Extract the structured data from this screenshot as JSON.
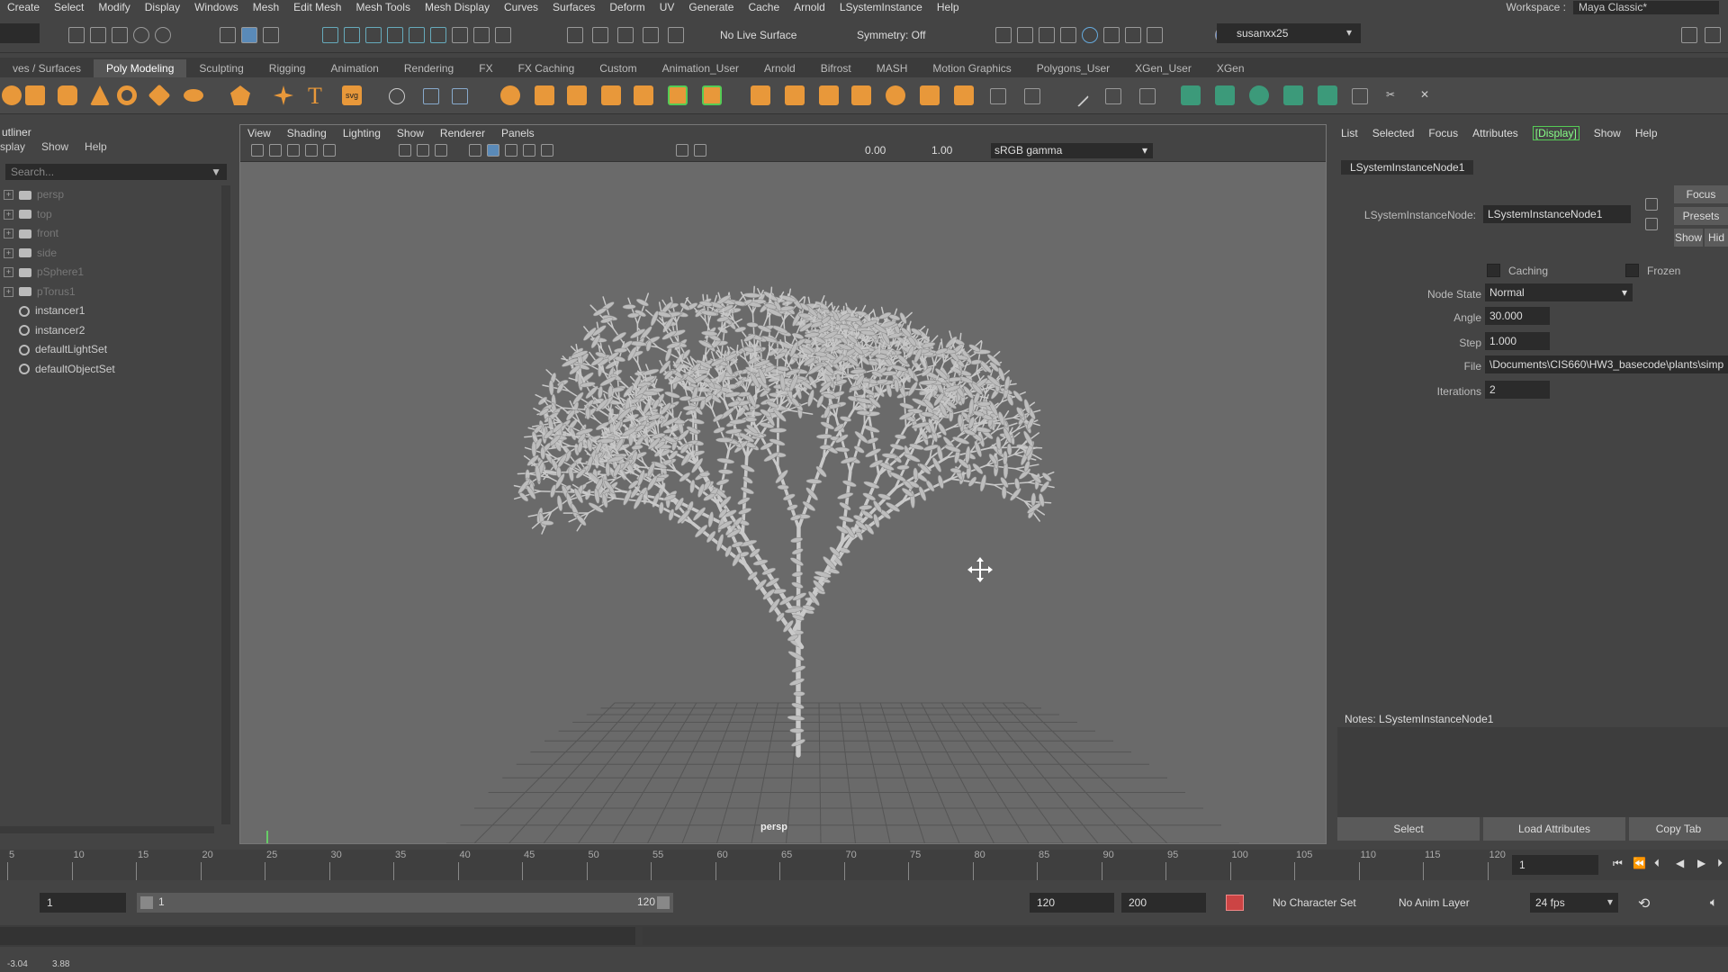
{
  "menubar": {
    "items": [
      "Create",
      "Select",
      "Modify",
      "Display",
      "Windows",
      "Mesh",
      "Edit Mesh",
      "Mesh Tools",
      "Mesh Display",
      "Curves",
      "Surfaces",
      "Deform",
      "UV",
      "Generate",
      "Cache",
      "Arnold",
      "LSystemInstance",
      "Help"
    ],
    "workspace_label": "Workspace :",
    "workspace_value": "Maya Classic*"
  },
  "statusline": {
    "live_surface": "No Live Surface",
    "symmetry": "Symmetry: Off",
    "user": "susanxx25"
  },
  "shelf": {
    "tabs": [
      "ves / Surfaces",
      "Poly Modeling",
      "Sculpting",
      "Rigging",
      "Animation",
      "Rendering",
      "FX",
      "FX Caching",
      "Custom",
      "Animation_User",
      "Arnold",
      "Bifrost",
      "MASH",
      "Motion Graphics",
      "Polygons_User",
      "XGen_User",
      "XGen"
    ],
    "active_tab": "Poly Modeling",
    "icon_names": [
      "sphere-icon",
      "cube-icon",
      "cylinder-icon",
      "cone-icon",
      "torus-icon",
      "plane-icon",
      "disc-icon",
      "platonic-icon",
      "star-icon",
      "text-icon",
      "svg-icon"
    ]
  },
  "outliner": {
    "title": "utliner",
    "menu": [
      "splay",
      "Show",
      "Help"
    ],
    "search_placeholder": "Search...",
    "items": [
      {
        "label": "persp",
        "expandable": true,
        "dim": true
      },
      {
        "label": "top",
        "expandable": true,
        "dim": true
      },
      {
        "label": "front",
        "expandable": true,
        "dim": true
      },
      {
        "label": "side",
        "expandable": true,
        "dim": true
      },
      {
        "label": "pSphere1",
        "expandable": true,
        "dim": true
      },
      {
        "label": "pTorus1",
        "expandable": true,
        "dim": true
      },
      {
        "label": "instancer1",
        "expandable": false,
        "dim": false
      },
      {
        "label": "instancer2",
        "expandable": false,
        "dim": false
      },
      {
        "label": "defaultLightSet",
        "expandable": false,
        "dim": false
      },
      {
        "label": "defaultObjectSet",
        "expandable": false,
        "dim": false
      }
    ]
  },
  "viewport": {
    "menu": [
      "View",
      "Shading",
      "Lighting",
      "Show",
      "Renderer",
      "Panels"
    ],
    "exposure": "0.00",
    "gamma_value": "1.00",
    "color_space": "sRGB gamma",
    "camera_label": "persp"
  },
  "attribute_editor": {
    "menu": [
      "List",
      "Selected",
      "Focus",
      "Attributes",
      "[Display]",
      "Show",
      "Help"
    ],
    "node_tab": "LSystemInstanceNode1",
    "node_label": "LSystemInstanceNode:",
    "node_value": "LSystemInstanceNode1",
    "side_buttons": [
      "Focus",
      "Presets",
      "Show",
      "Hid"
    ],
    "caching_label": "Caching",
    "frozen_label": "Frozen",
    "node_state_label": "Node State",
    "node_state_value": "Normal",
    "angle_label": "Angle",
    "angle_value": "30.000",
    "step_label": "Step",
    "step_value": "1.000",
    "file_label": "File",
    "file_value": "\\Documents\\CIS660\\HW3_basecode\\plants\\simp",
    "iterations_label": "Iterations",
    "iterations_value": "2",
    "notes_label": "Notes:  LSystemInstanceNode1",
    "buttons": [
      "Select",
      "Load Attributes",
      "Copy Tab"
    ]
  },
  "timeline": {
    "ticks": [
      "5",
      "10",
      "15",
      "20",
      "25",
      "30",
      "35",
      "40",
      "45",
      "50",
      "55",
      "60",
      "65",
      "70",
      "75",
      "80",
      "85",
      "90",
      "95",
      "100",
      "105",
      "110",
      "115",
      "120"
    ],
    "current_frame": "1"
  },
  "range": {
    "start": "1",
    "inner_start": "1",
    "inner_end": "120",
    "end": "120",
    "max_end": "200",
    "character_set": "No Character Set",
    "anim_layer": "No Anim Layer",
    "fps": "24 fps"
  },
  "helpline": {
    "left_value": "-3.04",
    "right_value": "3.88"
  },
  "colors": {
    "accent_green": "#5c5",
    "panel_bg": "#444444",
    "viewport_bg": "#6a6a6a"
  }
}
